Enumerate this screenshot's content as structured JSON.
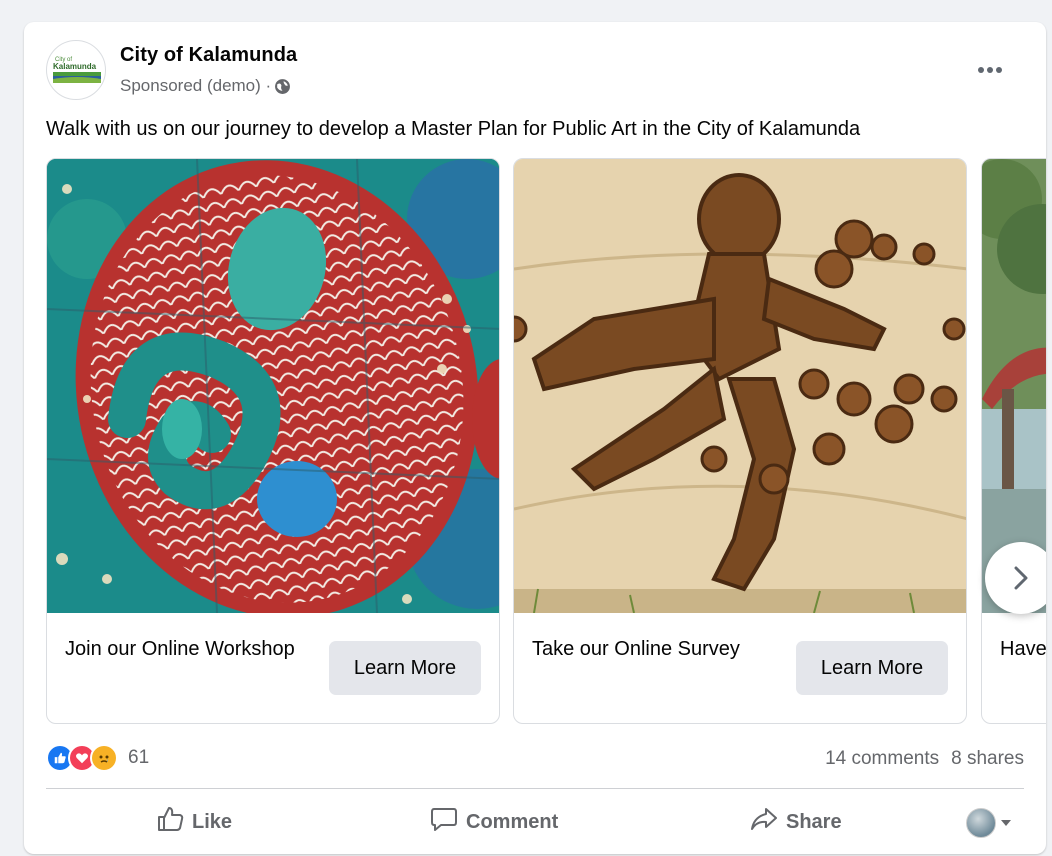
{
  "post": {
    "page_name": "City of Kalamunda",
    "sponsored": "Sponsored (demo) ·",
    "caption": "Walk with us on our journey to develop a Master Plan for Public Art in the City of Kalamunda",
    "logo_text_top": "City of",
    "logo_text_main": "Kalamunda"
  },
  "cards": [
    {
      "title": "Join our Online Workshop",
      "button": "Learn More"
    },
    {
      "title": "Take our Online Survey",
      "button": "Learn More"
    },
    {
      "title": "Have"
    }
  ],
  "stats": {
    "reaction_count": "61",
    "comments": "14 comments",
    "shares": "8 shares"
  },
  "actions": {
    "like": "Like",
    "comment": "Comment",
    "share": "Share"
  },
  "icons": {
    "more": "more-options-icon",
    "globe": "globe-icon",
    "next": "chevron-right-icon",
    "like": "thumbs-up-icon",
    "comment": "comment-bubble-icon",
    "share": "share-arrow-icon",
    "caret": "caret-down-icon"
  },
  "colors": {
    "like_blue": "#1877f2",
    "love_red": "#f33e58",
    "sad_yellow": "#f7b125",
    "button_gray": "#e4e6eb",
    "secondary_text": "#65676b"
  }
}
